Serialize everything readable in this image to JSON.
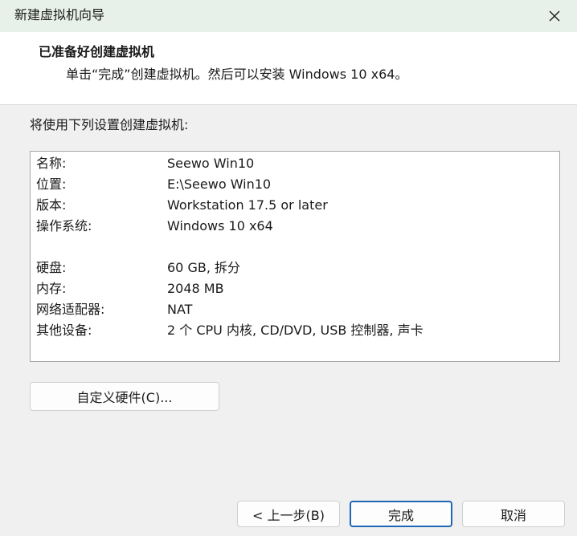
{
  "window": {
    "title": "新建虚拟机向导"
  },
  "header": {
    "title": "已准备好创建虚拟机",
    "subtitle": "单击“完成”创建虚拟机。然后可以安装 Windows 10 x64。"
  },
  "summary": {
    "label": "将使用下列设置创建虚拟机:",
    "rows": [
      {
        "key": "名称:",
        "value": "Seewo Win10"
      },
      {
        "key": "位置:",
        "value": "E:\\Seewo Win10"
      },
      {
        "key": "版本:",
        "value": "Workstation 17.5 or later"
      },
      {
        "key": "操作系统:",
        "value": "Windows 10 x64"
      },
      {
        "key": "硬盘:",
        "value": "60 GB, 拆分"
      },
      {
        "key": "内存:",
        "value": "2048 MB"
      },
      {
        "key": "网络适配器:",
        "value": "NAT"
      },
      {
        "key": "其他设备:",
        "value": "2 个 CPU 内核, CD/DVD, USB 控制器, 声卡"
      }
    ]
  },
  "buttons": {
    "customize": "自定义硬件(C)...",
    "back": "< 上一步(B)",
    "finish": "完成",
    "cancel": "取消"
  },
  "icons": {
    "close": "close-icon"
  }
}
